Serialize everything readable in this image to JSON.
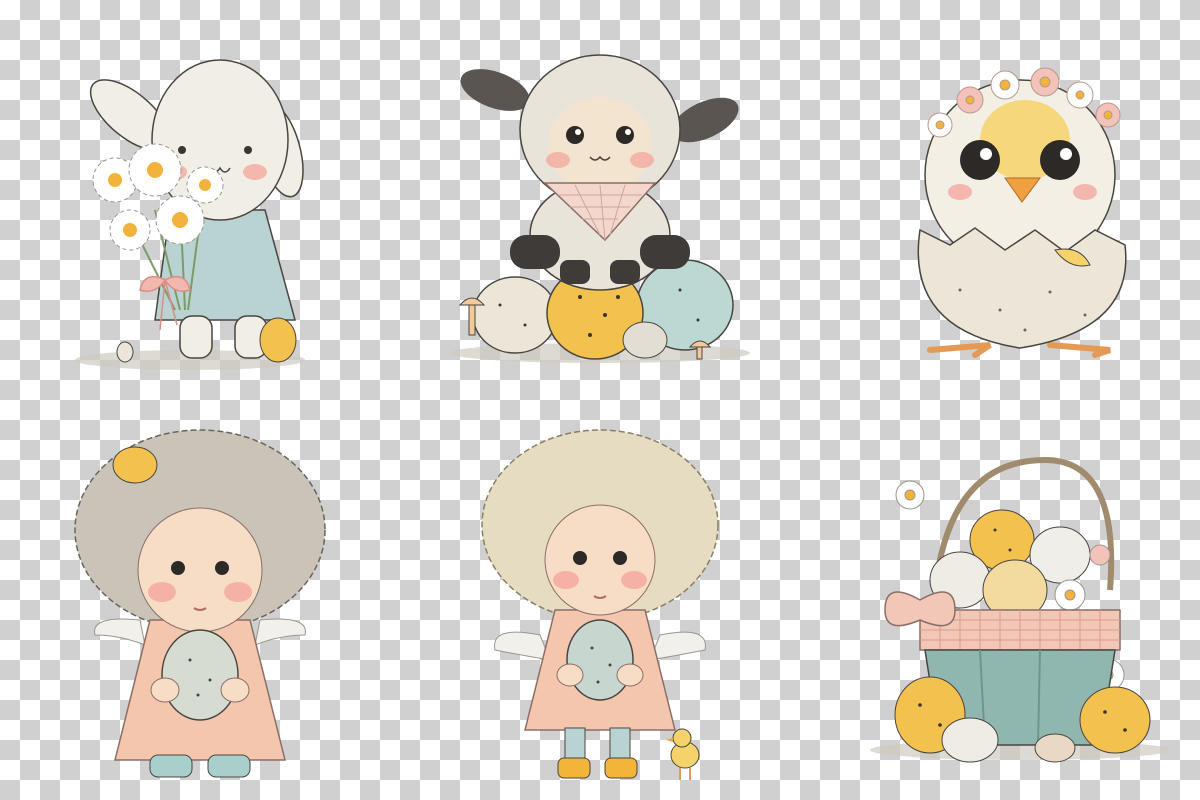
{
  "palette": {
    "bunny_fur": "#f1eee6",
    "cheek": "#f4a9a0",
    "dress_blue": "#b9d3d2",
    "ribbon_pink": "#f2b8b0",
    "daisy_white": "#ffffff",
    "daisy_center": "#f2b33d",
    "egg_yellow": "#f2c14e",
    "egg_mint": "#bcd8d2",
    "egg_cream": "#ece6d8",
    "lamb_wool": "#e9e4da",
    "lamb_dark": "#3f3b38",
    "chick_yellow": "#f6d26a",
    "beak_orange": "#f0a040",
    "hair_grey": "#c9c3b8",
    "hair_blonde": "#e6dcc2",
    "skin": "#f7ddc6",
    "dress_peach": "#f4c6ae",
    "boot_mint": "#a9cfcb",
    "boot_yellow": "#f2b53a",
    "basket_teal": "#8fb7b0",
    "gingham": "#f3c7b8",
    "outline": "#4a4540"
  },
  "figures": [
    {
      "subject": "bunny-with-daisies"
    },
    {
      "subject": "lamb-on-eggs"
    },
    {
      "subject": "chick-in-eggshell"
    },
    {
      "subject": "curly-grey-hair-girl-with-egg"
    },
    {
      "subject": "curly-blonde-girl-with-egg-and-chick"
    },
    {
      "subject": "easter-basket-with-eggs"
    }
  ]
}
